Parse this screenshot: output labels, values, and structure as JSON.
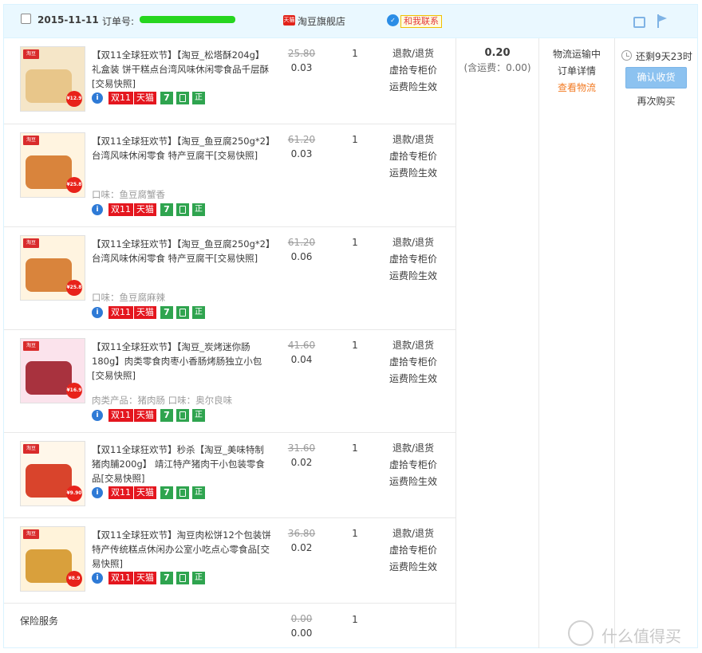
{
  "header": {
    "date": "2015-11-11",
    "order_label": "订单号:",
    "shop_badge": "天猫",
    "shop_name": "淘豆旗舰店",
    "contact": "和我联系"
  },
  "items": [
    {
      "title": "【双11全球狂欢节】【淘豆_松塔酥204g】礼盒装 饼干糕点台湾风味休闲零食品千层酥[交易快照]",
      "attr": "",
      "orig_price": "25.80",
      "price": "0.03",
      "qty": "1",
      "thumb_price": "¥12.9",
      "services": [
        "退款/退货",
        "虚拾专柜价",
        "运费险生效"
      ]
    },
    {
      "title": "【双11全球狂欢节】【淘豆_鱼豆腐250g*2】台湾风味休闲零食 特产豆腐干[交易快照]",
      "attr": "口味：鱼豆腐蟹香",
      "orig_price": "61.20",
      "price": "0.03",
      "qty": "1",
      "thumb_price": "¥25.8",
      "services": [
        "退款/退货",
        "虚拾专柜价",
        "运费险生效"
      ]
    },
    {
      "title": "【双11全球狂欢节】【淘豆_鱼豆腐250g*2】台湾风味休闲零食 特产豆腐干[交易快照]",
      "attr": "口味：鱼豆腐麻辣",
      "orig_price": "61.20",
      "price": "0.06",
      "qty": "1",
      "thumb_price": "¥25.8",
      "services": [
        "退款/退货",
        "虚拾专柜价",
        "运费险生效"
      ]
    },
    {
      "title": "【双11全球狂欢节】【淘豆_炭烤迷你肠180g】肉类零食肉枣小香肠烤肠独立小包[交易快照]",
      "attr": "肉类产品：猪肉肠  口味：奥尔良味",
      "orig_price": "41.60",
      "price": "0.04",
      "qty": "1",
      "thumb_price": "¥16.9",
      "services": [
        "退款/退货",
        "虚拾专柜价",
        "运费险生效"
      ]
    },
    {
      "title": "【双11全球狂欢节】秒杀【淘豆_美味特制猪肉脯200g】 靖江特产猪肉干小包装零食品[交易快照]",
      "attr": "",
      "orig_price": "31.60",
      "price": "0.02",
      "qty": "1",
      "thumb_price": "¥9.90",
      "services": [
        "退款/退货",
        "虚拾专柜价",
        "运费险生效"
      ]
    },
    {
      "title": "【双11全球狂欢节】淘豆肉松饼12个包装饼特产传统糕点休闲办公室小吃点心零食品[交易快照]",
      "attr": "",
      "orig_price": "36.80",
      "price": "0.02",
      "qty": "1",
      "thumb_price": "¥8.9",
      "services": [
        "退款/退货",
        "虚拾专柜价",
        "运费险生效"
      ]
    }
  ],
  "badges": {
    "double11": "双11",
    "tmall": "天猫",
    "seven": "7",
    "zheng": "正",
    "info": "i"
  },
  "insurance": {
    "label": "保险服务",
    "orig_price": "0.00",
    "price": "0.00",
    "qty": "1"
  },
  "payment": {
    "amount": "0.20",
    "shipping": "(含运费：0.00)"
  },
  "status": {
    "text": "物流运输中",
    "detail": "订单详情",
    "logistics": "查看物流"
  },
  "actions": {
    "remaining": "还剩9天23时",
    "confirm": "确认收货",
    "rebuy": "再次购买"
  },
  "watermark": {
    "text": "什么值得买"
  },
  "thumb_logo": "淘豆",
  "colors": {
    "accent": "#e4161e",
    "header_bg": "#eaf8ff",
    "logistics": "#f27b24",
    "button": "#8cc2f0"
  }
}
